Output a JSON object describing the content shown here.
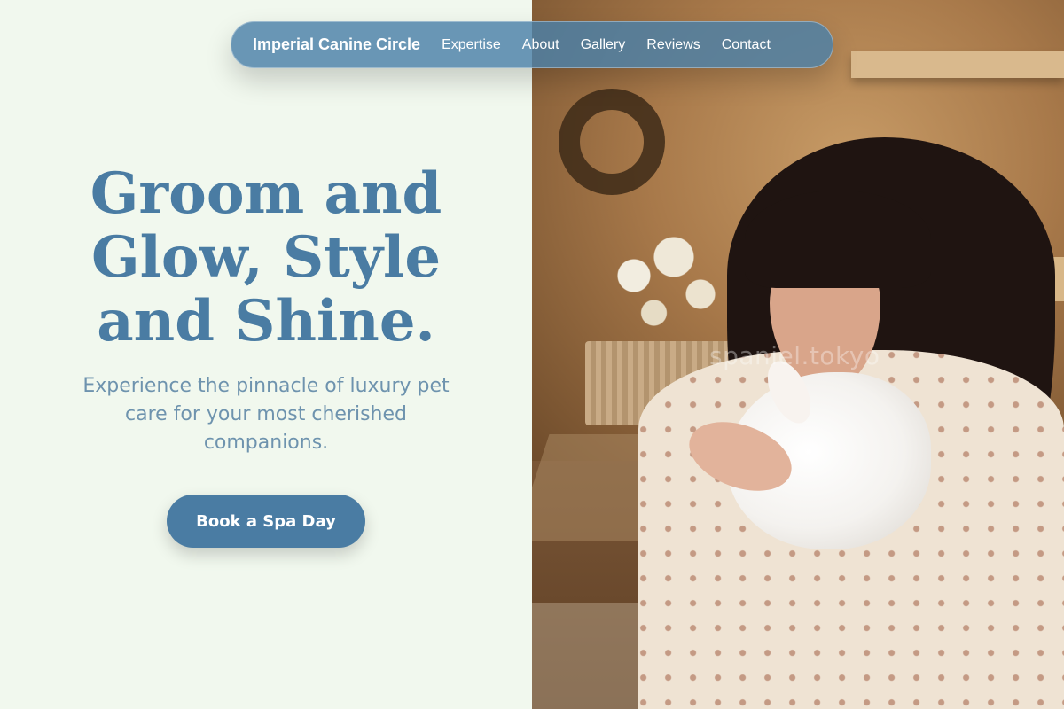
{
  "nav": {
    "brand": "Imperial Canine Circle",
    "links": [
      "Expertise",
      "About",
      "Gallery",
      "Reviews",
      "Contact"
    ]
  },
  "hero": {
    "headline_lines": [
      "Groom and",
      "Glow, Style",
      "and Shine."
    ],
    "subtitle": "Experience the pinnacle of luxury pet care for your most cherished companions.",
    "cta_label": "Book a Spa Day"
  },
  "image": {
    "watermark": "spaniel.tokyo"
  },
  "colors": {
    "accent": "#4a7ca3",
    "background": "#f1f8ee",
    "subtitle": "#6e93ae",
    "navbar": "#4a80a8"
  }
}
